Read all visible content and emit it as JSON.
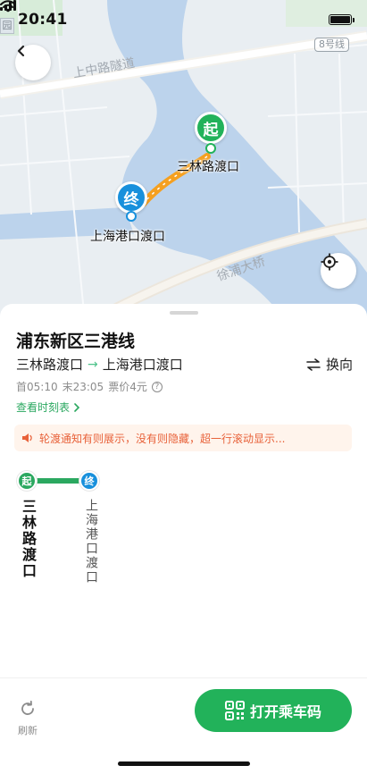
{
  "status_bar": {
    "time": "20:41"
  },
  "map": {
    "corner_chip": "园",
    "metro_badge": "8号线",
    "road_labels": [
      "上中路隧道",
      "徐浦大桥"
    ],
    "start_marker": {
      "badge": "起",
      "label": "三林路渡口"
    },
    "end_marker": {
      "badge": "终",
      "label": "上海港口渡口"
    },
    "colors": {
      "water": "#bcd3ec",
      "land": "#e9eef2",
      "green_area": "#d7ecd9",
      "route_orange": "#f5a020"
    }
  },
  "sheet": {
    "line_name": "浦东新区三港线",
    "route": {
      "from": "三林路渡口",
      "arrow": "→",
      "to": "上海港口渡口"
    },
    "swap_label": "换向",
    "meta": {
      "first": "首05:10",
      "last": "末23:05",
      "fare": "票价4元",
      "info_icon": "?"
    },
    "timetable_link": "查看时刻表",
    "notice": "轮渡通知有则展示，没有则隐藏，超一行滚动显示...",
    "stops": [
      {
        "badge": "起",
        "name": "三林路渡口"
      },
      {
        "badge": "终",
        "name": "上海港口渡口"
      }
    ]
  },
  "bottom_bar": {
    "refresh_label": "刷新",
    "qr_button_label": "打开乘车码"
  },
  "colors": {
    "accent_green": "#22b25a",
    "accent_blue": "#1890dc",
    "notice_orange": "#e8623a"
  }
}
